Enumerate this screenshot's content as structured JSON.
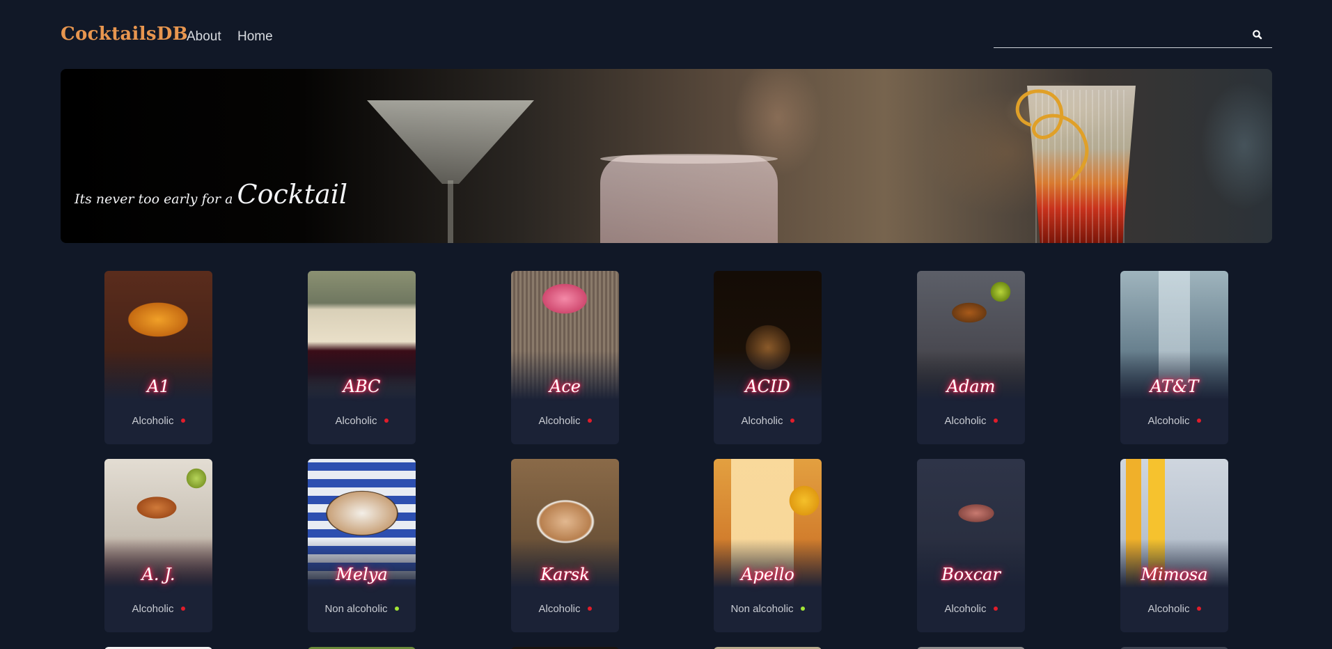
{
  "header": {
    "logo": "CocktailsDB",
    "nav": [
      {
        "label": "About"
      },
      {
        "label": "Home"
      }
    ],
    "search": {
      "placeholder": "",
      "value": ""
    },
    "search_icon": "search-icon"
  },
  "hero": {
    "tagline_small": "Its never too early for a ",
    "tagline_big": "Cocktail"
  },
  "colors": {
    "background": "#111827",
    "logo": "#e8964f",
    "card": "#1b2236",
    "name_glow": "#ff2a5a",
    "alcoholic_dot": "#e11d2a",
    "non_alcoholic_dot": "#a3e635"
  },
  "cocktails": [
    {
      "name": "A1",
      "type": "Alcoholic",
      "alcoholic": true
    },
    {
      "name": "ABC",
      "type": "Alcoholic",
      "alcoholic": true
    },
    {
      "name": "Ace",
      "type": "Alcoholic",
      "alcoholic": true
    },
    {
      "name": "ACID",
      "type": "Alcoholic",
      "alcoholic": true
    },
    {
      "name": "Adam",
      "type": "Alcoholic",
      "alcoholic": true
    },
    {
      "name": "AT&T",
      "type": "Alcoholic",
      "alcoholic": true
    },
    {
      "name": "A. J.",
      "type": "Alcoholic",
      "alcoholic": true
    },
    {
      "name": "Melya",
      "type": "Non alcoholic",
      "alcoholic": false
    },
    {
      "name": "Karsk",
      "type": "Alcoholic",
      "alcoholic": true
    },
    {
      "name": "Apello",
      "type": "Non alcoholic",
      "alcoholic": false
    },
    {
      "name": "Boxcar",
      "type": "Alcoholic",
      "alcoholic": true
    },
    {
      "name": "Mimosa",
      "type": "Alcoholic",
      "alcoholic": true
    }
  ]
}
